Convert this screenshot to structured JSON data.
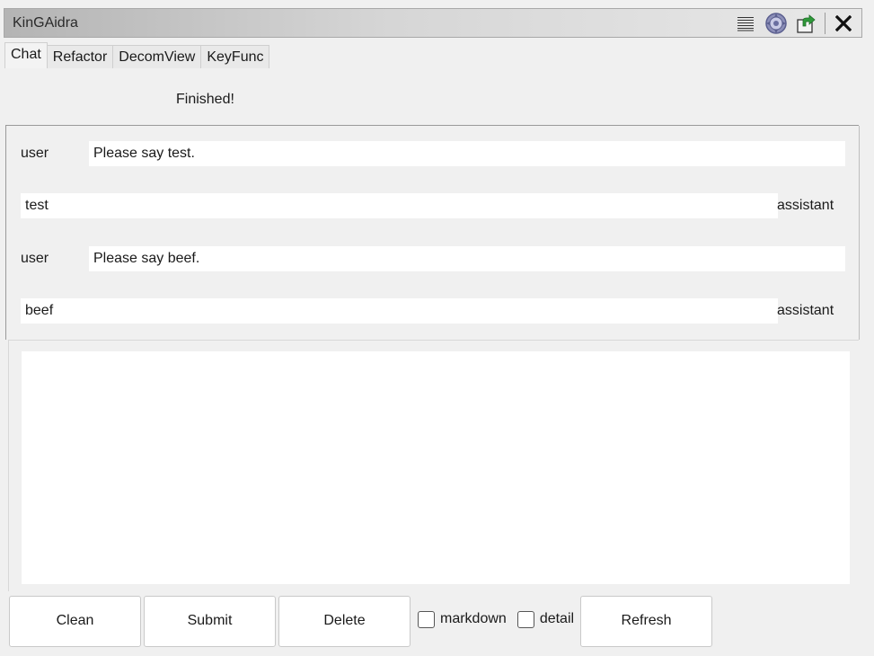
{
  "window": {
    "title": "KinGAidra",
    "icons": [
      "list-icon",
      "settings-gear-icon",
      "export-icon",
      "close-icon"
    ]
  },
  "tabs": [
    {
      "label": "Chat",
      "active": true
    },
    {
      "label": "Refactor",
      "active": false
    },
    {
      "label": "DecomView",
      "active": false
    },
    {
      "label": "KeyFunc",
      "active": false
    }
  ],
  "status": {
    "text": "Finished!"
  },
  "chat": {
    "messages": [
      {
        "role": "user",
        "content": "Please say test."
      },
      {
        "role": "assistant",
        "content": "test"
      },
      {
        "role": "user",
        "content": "Please say beef."
      },
      {
        "role": "assistant",
        "content": "beef"
      }
    ]
  },
  "input": {
    "value": ""
  },
  "buttons": {
    "clean": "Clean",
    "submit": "Submit",
    "delete": "Delete",
    "refresh": "Refresh"
  },
  "options": {
    "markdown": {
      "label": "markdown",
      "checked": false
    },
    "detail": {
      "label": "detail",
      "checked": false
    }
  }
}
